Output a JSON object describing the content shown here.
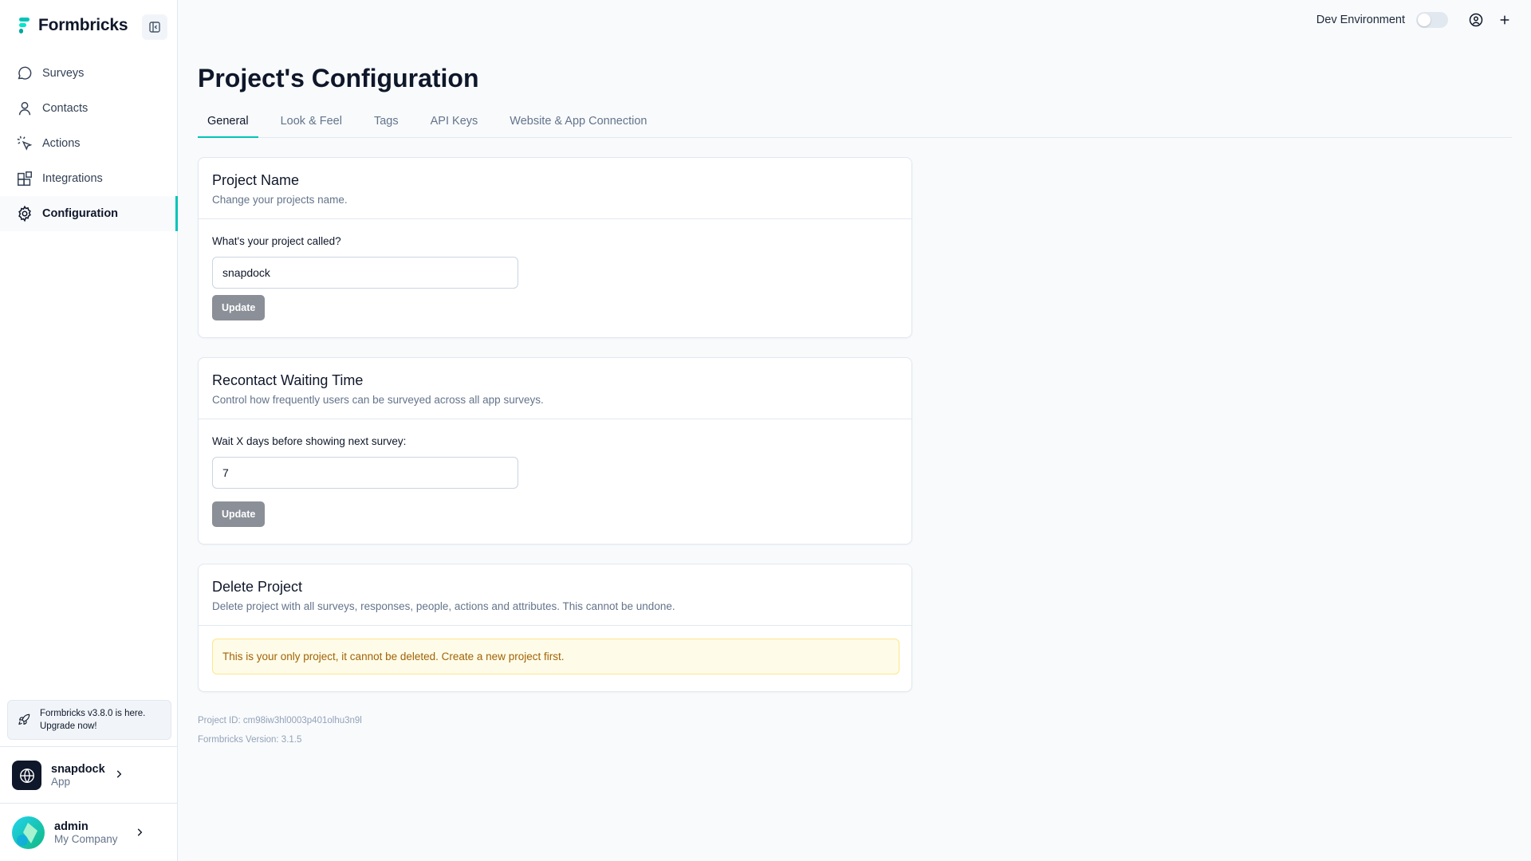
{
  "brand": {
    "name": "Formbricks"
  },
  "sidebar": {
    "items": [
      {
        "label": "Surveys",
        "icon": "message-circle-icon"
      },
      {
        "label": "Contacts",
        "icon": "user-icon"
      },
      {
        "label": "Actions",
        "icon": "pointer-click-icon"
      },
      {
        "label": "Integrations",
        "icon": "blocks-icon"
      },
      {
        "label": "Configuration",
        "icon": "gear-icon",
        "active": true
      }
    ],
    "upgrade": {
      "text": "Formbricks v3.8.0 is here. Upgrade now!"
    },
    "project": {
      "name": "snapdock",
      "type": "App"
    },
    "user": {
      "name": "admin",
      "company": "My Company"
    }
  },
  "topbar": {
    "env_label": "Dev Environment",
    "env_enabled": false
  },
  "main": {
    "title": "Project's Configuration",
    "tabs": [
      {
        "label": "General",
        "active": true
      },
      {
        "label": "Look & Feel"
      },
      {
        "label": "Tags"
      },
      {
        "label": "API Keys"
      },
      {
        "label": "Website & App Connection"
      }
    ],
    "project_name": {
      "title": "Project Name",
      "description": "Change your projects name.",
      "field_label": "What's your project called?",
      "value": "snapdock",
      "button": "Update"
    },
    "recontact": {
      "title": "Recontact Waiting Time",
      "description": "Control how frequently users can be surveyed across all app surveys.",
      "field_label": "Wait X days before showing next survey:",
      "value": "7",
      "button": "Update"
    },
    "delete_project": {
      "title": "Delete Project",
      "description": "Delete project with all surveys, responses, people, actions and attributes. This cannot be undone.",
      "alert": "This is your only project, it cannot be deleted. Create a new project first."
    },
    "project_id": "Project ID: cm98iw3hl0003p401olhu3n9l",
    "version": "Formbricks Version: 3.1.5"
  },
  "colors": {
    "accent": "#00c4b8",
    "button": "#8a8f98",
    "alert_bg": "#fefce8",
    "alert_text": "#a16207"
  }
}
